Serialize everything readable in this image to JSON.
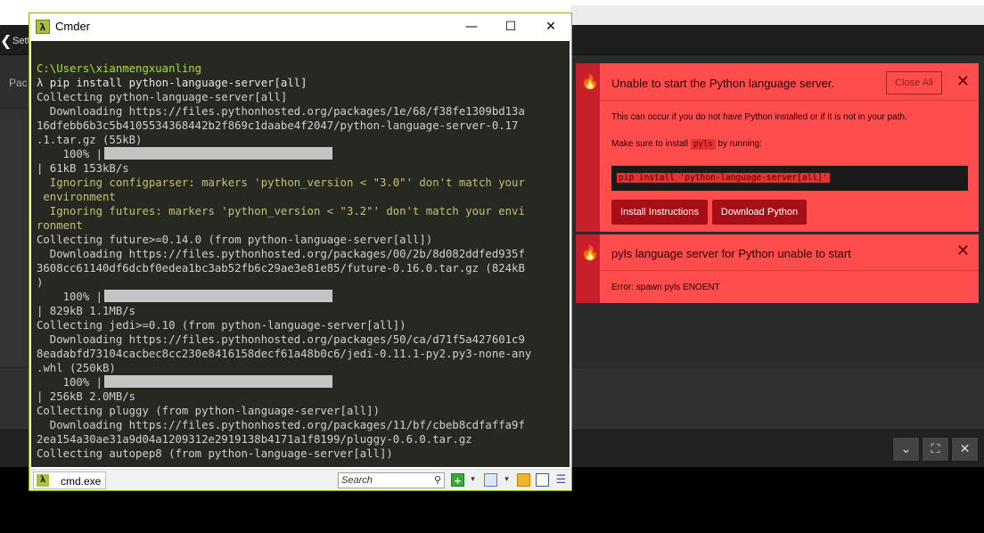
{
  "background": {
    "back_label": "Setti",
    "sidebar_label": "Pac",
    "bottom_buttons": [
      "⌄",
      "⛶",
      "✕"
    ]
  },
  "cmder": {
    "title": "Cmder",
    "logo": "λ",
    "window_controls": {
      "minimize": "—",
      "maximize": "☐",
      "close": "✕"
    },
    "terminal_lines": [
      {
        "text": "C:\\Users\\xianmengxuanling",
        "color": "green"
      },
      {
        "text": "λ pip install python-language-server[all]",
        "color": "white"
      },
      {
        "text": "Collecting python-language-server[all]",
        "color": "default"
      },
      {
        "text": "  Downloading https://files.pythonhosted.org/packages/1e/68/f38fe1309bd13a",
        "color": "default"
      },
      {
        "text": "16dfebb6b3c5b4105534368442b2f869c1daabe4f2047/python-language-server-0.17",
        "color": "default"
      },
      {
        "text": ".1.tar.gz (55kB)",
        "color": "default"
      },
      {
        "text": "    100% |",
        "color": "default",
        "bar": true
      },
      {
        "text": "| 61kB 153kB/s",
        "color": "default"
      },
      {
        "text": "  Ignoring configparser: markers 'python_version < \"3.0\"' don't match your",
        "color": "yellow"
      },
      {
        "text": " environment",
        "color": "yellow"
      },
      {
        "text": "  Ignoring futures: markers 'python_version < \"3.2\"' don't match your envi",
        "color": "yellow"
      },
      {
        "text": "ronment",
        "color": "yellow"
      },
      {
        "text": "Collecting future>=0.14.0 (from python-language-server[all])",
        "color": "default"
      },
      {
        "text": "  Downloading https://files.pythonhosted.org/packages/00/2b/8d082ddfed935f",
        "color": "default"
      },
      {
        "text": "3608cc61140df6dcbf0edea1bc3ab52fb6c29ae3e81e85/future-0.16.0.tar.gz (824kB",
        "color": "default"
      },
      {
        "text": ")",
        "color": "default"
      },
      {
        "text": "    100% |",
        "color": "default",
        "bar": true
      },
      {
        "text": "| 829kB 1.1MB/s",
        "color": "default"
      },
      {
        "text": "Collecting jedi>=0.10 (from python-language-server[all])",
        "color": "default"
      },
      {
        "text": "  Downloading https://files.pythonhosted.org/packages/50/ca/d71f5a427601c9",
        "color": "default"
      },
      {
        "text": "8eadabfd73104cacbec8cc230e8416158decf61a48b0c6/jedi-0.11.1-py2.py3-none-any",
        "color": "default"
      },
      {
        "text": ".whl (250kB)",
        "color": "default"
      },
      {
        "text": "    100% |",
        "color": "default",
        "bar": true
      },
      {
        "text": "| 256kB 2.0MB/s",
        "color": "default"
      },
      {
        "text": "Collecting pluggy (from python-language-server[all])",
        "color": "default"
      },
      {
        "text": "  Downloading https://files.pythonhosted.org/packages/11/bf/cbeb8cdfaffa9f",
        "color": "default"
      },
      {
        "text": "2ea154a30ae31a9d04a1209312e2919138b4171a1f8199/pluggy-0.6.0.tar.gz",
        "color": "default"
      },
      {
        "text": "Collecting autopep8 (from python-language-server[all])",
        "color": "default"
      }
    ],
    "statusbar": {
      "tab_icon": "λ",
      "tab_label": "cmd.exe",
      "search_placeholder": "Search",
      "search_icon": "⚲",
      "add_icon": "+",
      "dropdown_icon": "▾",
      "menu_icon": "☰"
    }
  },
  "notifications": [
    {
      "icon": "flame-icon",
      "flame": "🔥",
      "title": "Unable to start the Python language server.",
      "close_all": "Close All",
      "close": "✕",
      "body_line1": "This can occur if you do not have Python installed or if it is not in your path.",
      "body_line2_pre": "Make sure to install ",
      "body_line2_code": "pyls",
      "body_line2_post": " by running:",
      "code": "pip install 'python-language-server[all]'",
      "buttons": [
        "Install Instructions",
        "Download Python"
      ]
    },
    {
      "icon": "flame-icon",
      "flame": "🔥",
      "title": "pyls language server for Python unable to start",
      "close": "✕",
      "body": "Error: spawn pyls ENOENT"
    }
  ],
  "colors": {
    "notification_bg": "#ff4d4d",
    "notification_stripe": "#c8202a",
    "terminal_bg": "#272822",
    "terminal_green": "#a6e22e",
    "terminal_yellow": "#c5c073"
  }
}
